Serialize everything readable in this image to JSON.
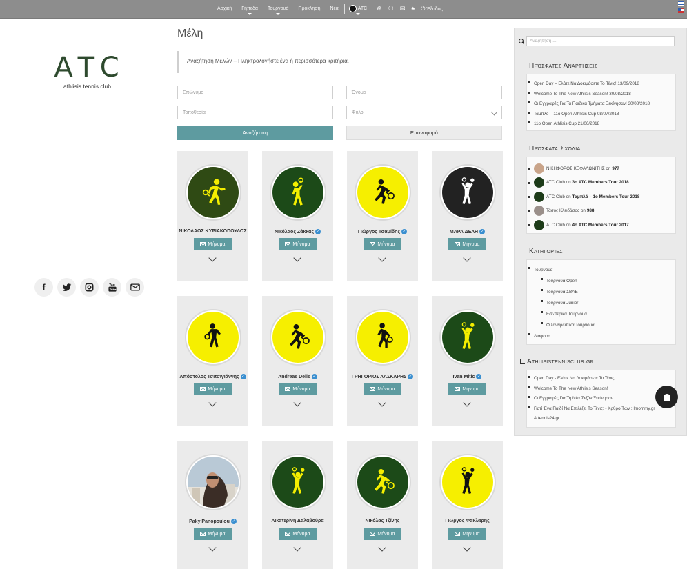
{
  "nav": {
    "items": [
      "Αρχική",
      "Γήπεδα",
      "Τουρνουά",
      "Πρόκληση",
      "Νέα"
    ],
    "atc_label": "ATC",
    "logout_label": "Έξοδος"
  },
  "logo": {
    "mark": "ATC",
    "subtitle": "athlisis tennis club"
  },
  "socials": [
    "facebook-icon",
    "twitter-icon",
    "instagram-icon",
    "youtube-icon",
    "mail-icon"
  ],
  "main": {
    "title": "Μέλη",
    "intro": "Αναζήτηση Μελών – Πληκτρολογήστε ένα ή περισσότερα κριτήρια.",
    "form": {
      "surname_placeholder": "Επώνυμο",
      "name_placeholder": "Όνομα",
      "location_placeholder": "Τοποθεσία",
      "gender_placeholder": "Φύλο",
      "search_label": "Αναζήτηση",
      "reset_label": "Επαναφορά"
    },
    "message_label": "Μήνυμα"
  },
  "members": [
    {
      "name": "ΝΙΚΟΛΑΟΣ ΚΥΡΙΑΚΟΠΟΥΛΟΣ",
      "verified": false,
      "bg": "#2f4a14",
      "fg": "#f4ee00",
      "pose": "forehand"
    },
    {
      "name": "Νικόλαος Ζάκκας",
      "verified": true,
      "bg": "#1c4a18",
      "fg": "#f4ee00",
      "pose": "serve"
    },
    {
      "name": "Γιώργος Τσαμίδης",
      "verified": true,
      "bg": "#f6ef00",
      "fg": "#111111",
      "pose": "lunge"
    },
    {
      "name": "ΜΑΡΑ ΔΕΛΗ",
      "verified": true,
      "bg": "#222222",
      "fg": "#ffffff",
      "pose": "overhead"
    },
    {
      "name": "Απόστολος Τσιτσιγιάννης",
      "verified": true,
      "bg": "#f6ef00",
      "fg": "#111111",
      "pose": "ready"
    },
    {
      "name": "Andreas Delis",
      "verified": true,
      "bg": "#f6ef00",
      "fg": "#111111",
      "pose": "lunge"
    },
    {
      "name": "ΓΡΗΓΟΡΙΟΣ ΛΑΣΚΑΡΗΣ",
      "verified": true,
      "bg": "#f6ef00",
      "fg": "#111111",
      "pose": "step"
    },
    {
      "name": "Ivan Mitic",
      "verified": true,
      "bg": "#1c4a18",
      "fg": "#f4ee00",
      "pose": "overhead"
    },
    {
      "name": "Paky Panopoulou",
      "verified": true,
      "bg": "photo",
      "fg": "#ffffff",
      "pose": "photo"
    },
    {
      "name": "Αικατερίνη Δαλαβούρα",
      "verified": false,
      "bg": "#1c4a18",
      "fg": "#f4ee00",
      "pose": "overhead"
    },
    {
      "name": "Νικόλας Τζίνης",
      "verified": false,
      "bg": "#1c4a18",
      "fg": "#f4ee00",
      "pose": "lunge"
    },
    {
      "name": "Γιωργος Φακλαρης",
      "verified": false,
      "bg": "#f6ef00",
      "fg": "#111111",
      "pose": "overhead"
    }
  ],
  "sidebar": {
    "search_placeholder": "Αναζήτηση ...",
    "recent_posts_title": "Πρόσφατες Αναρτήσεις",
    "recent_posts": [
      "Open Day – Ελάτε Να Δοκιμάσετε Το Τένις! 13/09/2018",
      "Welcome To The New Athlisis Season! 30/08/2018",
      "Οι Εγγραφές Για Τα Παιδικά Τμήματα Ξεκίνησαν! 30/08/2018",
      "Ταμπλό – 11ο Open Athlisis Cup 08/07/2018",
      "11ο Open Athlisis Cup 21/06/2018"
    ],
    "recent_comments_title": "Πρόσφατα Σχόλια",
    "recent_comments": [
      {
        "author": "ΝΙΚΗΦΟΡΟΣ ΚΕΦΑΛΩΝΙΤΗΣ",
        "on": "on",
        "post": "977",
        "avatar_color": "#c9a48a"
      },
      {
        "author": "ATC Club",
        "on": "on",
        "post": "3ο ATC Members Tour 2018",
        "avatar_color": "#1d3b19"
      },
      {
        "author": "ATC Club",
        "on": "on",
        "post": "Ταμπλό – 1ο Members Tour 2018",
        "avatar_color": "#1d3b19"
      },
      {
        "author": "Τάσος Κλειδάσος",
        "on": "on",
        "post": "988",
        "avatar_color": "#9a8f8a"
      },
      {
        "author": "ATC Club",
        "on": "on",
        "post": "4ο ATC Members Tour 2017",
        "avatar_color": "#1d3b19"
      }
    ],
    "categories_title": "Κατηγορίες",
    "categories": [
      {
        "label": "Τουρνουά",
        "sub": false
      },
      {
        "label": "Τουρνουά Open",
        "sub": true
      },
      {
        "label": "Τουρνουά ΣΒΑΕ",
        "sub": true
      },
      {
        "label": "Τουρνουά Junior",
        "sub": true
      },
      {
        "label": "Εσωτερικά Τουρνουά",
        "sub": true
      },
      {
        "label": "Φιλανθρωπικά Τουρνουά",
        "sub": true
      },
      {
        "label": "Διάφορα",
        "sub": false
      }
    ],
    "rss_title": "Athlisistennisclub.gr",
    "rss_items": [
      "Open Day - Ελάτε Να Δοκιμάσετε Το Τένις!",
      "Welcome To The New Athlisis Season!",
      "Οι Εγγραφές Για Τη Νέα Σεζόν Ξεκίνησαν",
      "Γιατί Ένα Παιδί Να Επιλέξει Το Τένις; - Κρθρο Των : Imommy.gr",
      "& tennis24.gr"
    ]
  }
}
